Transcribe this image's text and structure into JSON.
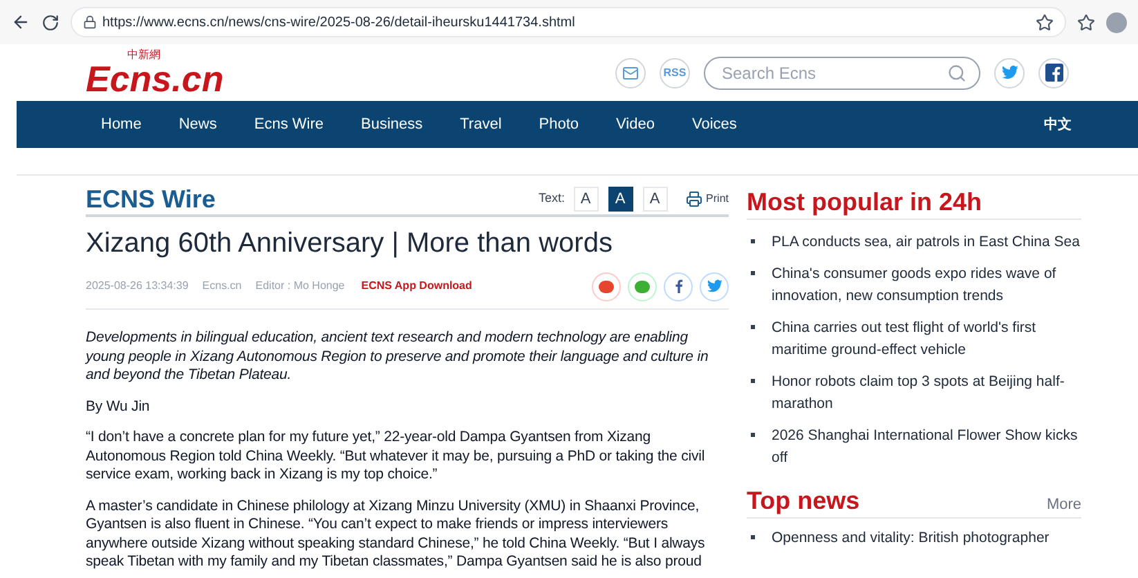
{
  "browser": {
    "url": "https://www.ecns.cn/news/cns-wire/2025-08-26/detail-iheursku1441734.shtml"
  },
  "header": {
    "logo_small": "中新網",
    "logo": "Ecns.cn",
    "rss": "RSS",
    "search": {
      "placeholder": "Search Ecns"
    }
  },
  "nav": {
    "items": [
      "Home",
      "News",
      "Ecns Wire",
      "Business",
      "Travel",
      "Photo",
      "Video",
      "Voices"
    ],
    "language": "中文"
  },
  "article": {
    "section": "ECNS Wire",
    "text_label": "Text:",
    "text_sizes": [
      {
        "label": "A",
        "selected": false
      },
      {
        "label": "A",
        "selected": true
      },
      {
        "label": "A",
        "selected": false
      }
    ],
    "print": "Print",
    "title": "Xizang 60th Anniversary | More than words",
    "meta": {
      "date": "2025-08-26 13:34:39",
      "source": "Ecns.cn",
      "editor": "Editor : Mo Honge",
      "app_link": "ECNS App Download"
    },
    "paragraphs": [
      {
        "kind": "lead",
        "text": "Developments in bilingual education, ancient text research and modern technology are enabling young people in Xizang Autonomous Region to preserve and promote their language and culture in and beyond the Tibetan Plateau."
      },
      {
        "kind": "body",
        "text": "By Wu Jin"
      },
      {
        "kind": "body",
        "text": "“I don’t have a concrete plan for my future yet,” 22-year-old Dampa Gyantsen from Xizang Autonomous Region told China Weekly. “But whatever it may be, pursuing a PhD or taking the civil service exam, working back in Xizang is my top choice.”"
      },
      {
        "kind": "body",
        "text": "A master’s candidate in Chinese philology at Xizang Minzu University (XMU) in Shaanxi Province, Gyantsen is also fluent in Chinese. “You can’t expect to make friends or impress interviewers anywhere outside Xizang without speaking standard Chinese,” he told China Weekly. “But I always speak Tibetan with my family and my Tibetan classmates,” Dampa Gyantsen said he is also proud"
      }
    ]
  },
  "most_popular": {
    "title": "Most popular in 24h",
    "items": [
      "PLA conducts sea, air patrols in East China Sea",
      "China's consumer goods expo rides wave of innovation, new consumption trends",
      "China carries out test flight of world's first maritime ground-effect vehicle",
      "Honor robots claim top 3 spots at Beijing half-marathon",
      "2026 Shanghai International Flower Show kicks off"
    ]
  },
  "top_news": {
    "title": "Top news",
    "more": "More",
    "items": [
      "Openness and vitality: British photographer"
    ]
  }
}
